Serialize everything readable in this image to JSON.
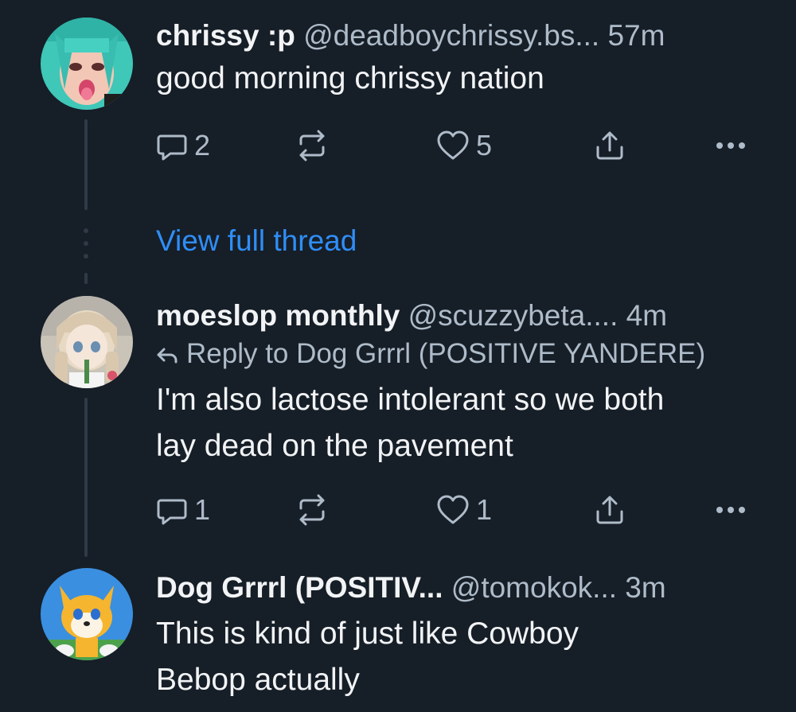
{
  "posts": [
    {
      "display_name": "chrissy :p",
      "handle": "@deadboychrissy.bs...",
      "time": "57m",
      "text": "good morning chrissy nation",
      "replies": "2",
      "reposts": "",
      "likes": "5",
      "avatar_icon": "avatar-teal-hair-icon"
    },
    {
      "display_name": "moeslop monthly",
      "handle": "@scuzzybeta....",
      "time": "4m",
      "reply_to": "Reply to Dog Grrrl (POSITIVE YANDERE)",
      "text_line1": "I'm also lactose intolerant so we both",
      "text_line2": "lay dead on the pavement",
      "replies": "1",
      "reposts": "",
      "likes": "1",
      "avatar_icon": "avatar-anime-girl-icon"
    },
    {
      "display_name": "Dog Grrrl (POSITIV...",
      "handle": "@tomokok...",
      "time": "3m",
      "text_line1": "This is kind of just like Cowboy",
      "text_line2": "Bebop actually",
      "avatar_icon": "avatar-fox-icon"
    }
  ],
  "view_full_thread": "View full thread",
  "colors": {
    "background": "#161e27",
    "text": "#f1f3f5",
    "muted": "#aebbc9",
    "link": "#2f8ef7",
    "thread_line": "#2e3a47"
  }
}
